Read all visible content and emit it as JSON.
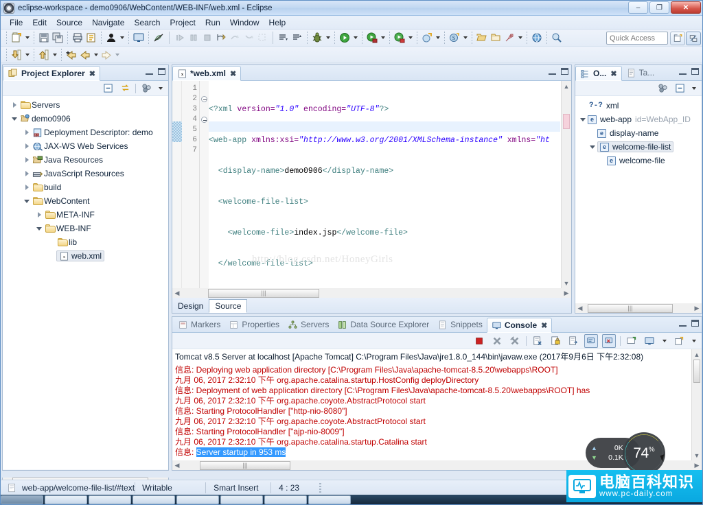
{
  "window": {
    "title": "eclipse-workspace - demo0906/WebContent/WEB-INF/web.xml - Eclipse",
    "minimize_label": "–",
    "restore_label": "❐",
    "close_label": "✕"
  },
  "menubar": {
    "items": [
      "File",
      "Edit",
      "Source",
      "Navigate",
      "Search",
      "Project",
      "Run",
      "Window",
      "Help"
    ]
  },
  "toolbar": {
    "quick_access_placeholder": "Quick Access",
    "row1_icons": [
      "new-wizard-icon",
      "new-wizard-dropdown",
      "save-icon",
      "save-all-icon",
      "print-icon",
      "link-icon",
      "person-icon",
      "person-dropdown",
      "open-console-icon",
      "toggle-mark-occurrences-icon",
      "resume-icon",
      "suspend-icon",
      "terminate-icon",
      "step-into-icon",
      "step-over-icon",
      "step-return-icon",
      "drop-to-frame-icon",
      "next-annotation-icon",
      "previous-annotation-icon",
      "debug-icon",
      "debug-dropdown",
      "run-icon",
      "run-dropdown",
      "run-server-icon",
      "run-server-dropdown",
      "stop-server-icon",
      "stop-server-dropdown",
      "new-java-project-icon",
      "new-java-project-dropdown",
      "new-servlet-icon",
      "new-servlet-dropdown",
      "open-type-icon",
      "open-task-icon",
      "rocket-icon",
      "rocket-dropdown",
      "web-browser-icon",
      "search-web-icon"
    ],
    "row2_icons": [
      "download-icon",
      "download-dropdown",
      "upload-icon",
      "upload-dropdown",
      "back-star-icon",
      "back-icon",
      "back-dropdown",
      "forward-icon",
      "forward-dropdown"
    ],
    "perspective_open_icon": "open-perspective-icon",
    "perspective_active_icon": "java-ee-perspective-icon"
  },
  "project_explorer": {
    "tab_label": "Project Explorer",
    "close_label": "✖",
    "view_icons": [
      "collapse-all-icon",
      "link-with-editor-icon",
      "view-menu-focus-icon",
      "view-menu-icon"
    ],
    "tree": [
      {
        "label": "Servers",
        "depth": 0,
        "arrow": "collapsed",
        "icon": "folder-icon",
        "selected": false
      },
      {
        "label": "demo0906",
        "depth": 0,
        "arrow": "expanded",
        "icon": "dynamic-web-project-icon",
        "selected": false
      },
      {
        "label": "Deployment Descriptor: demo",
        "depth": 1,
        "arrow": "collapsed",
        "icon": "deployment-descriptor-icon",
        "selected": false
      },
      {
        "label": "JAX-WS Web Services",
        "depth": 1,
        "arrow": "collapsed",
        "icon": "jaxws-icon",
        "selected": false
      },
      {
        "label": "Java Resources",
        "depth": 1,
        "arrow": "collapsed",
        "icon": "java-resources-icon",
        "selected": false
      },
      {
        "label": "JavaScript Resources",
        "depth": 1,
        "arrow": "collapsed",
        "icon": "javascript-resources-icon",
        "selected": false
      },
      {
        "label": "build",
        "depth": 1,
        "arrow": "collapsed",
        "icon": "folder-icon",
        "selected": false
      },
      {
        "label": "WebContent",
        "depth": 1,
        "arrow": "expanded",
        "icon": "folder-icon",
        "selected": false
      },
      {
        "label": "META-INF",
        "depth": 2,
        "arrow": "collapsed",
        "icon": "folder-icon",
        "selected": false
      },
      {
        "label": "WEB-INF",
        "depth": 2,
        "arrow": "expanded",
        "icon": "folder-icon",
        "selected": false
      },
      {
        "label": "lib",
        "depth": 3,
        "arrow": "none",
        "icon": "folder-icon",
        "selected": false
      },
      {
        "label": "web.xml",
        "depth": 3,
        "arrow": "none",
        "icon": "xml-file-icon",
        "selected": true
      }
    ]
  },
  "editor": {
    "tab_label": "*web.xml",
    "tab_icon": "xml-file-icon",
    "close_label": "✖",
    "footer_tabs": [
      {
        "label": "Design",
        "active": false
      },
      {
        "label": "Source",
        "active": true
      }
    ],
    "line_numbers": [
      "1",
      "2",
      "3",
      "4",
      "5",
      "6",
      "7"
    ],
    "lines": [
      {
        "n": 1,
        "fold": false,
        "segments": [
          {
            "t": "<?xml ",
            "c": "pi"
          },
          {
            "t": "version=",
            "c": "attr"
          },
          {
            "t": "\"1.0\"",
            "c": "str"
          },
          {
            "t": " encoding=",
            "c": "attr"
          },
          {
            "t": "\"UTF-8\"",
            "c": "str"
          },
          {
            "t": "?>",
            "c": "pi"
          }
        ]
      },
      {
        "n": 2,
        "fold": true,
        "segments": [
          {
            "t": "<web-app ",
            "c": "tag"
          },
          {
            "t": "xmlns:xsi=",
            "c": "attr"
          },
          {
            "t": "\"http://www.w3.org/2001/XMLSchema-instance\"",
            "c": "str"
          },
          {
            "t": " xmlns=",
            "c": "attr"
          },
          {
            "t": "\"ht",
            "c": "str"
          }
        ]
      },
      {
        "n": 3,
        "fold": false,
        "segments": [
          {
            "t": "  <display-name>",
            "c": "tag"
          },
          {
            "t": "demo0906",
            "c": "txt"
          },
          {
            "t": "</display-name>",
            "c": "tag"
          }
        ]
      },
      {
        "n": 4,
        "fold": true,
        "segments": [
          {
            "t": "  <welcome-file-list>",
            "c": "tag"
          }
        ]
      },
      {
        "n": 5,
        "fold": false,
        "segments": [
          {
            "t": "    <welcome-file>",
            "c": "tag"
          },
          {
            "t": "index.jsp",
            "c": "txt"
          },
          {
            "t": "</welcome-file>",
            "c": "tag"
          }
        ]
      },
      {
        "n": 6,
        "fold": false,
        "segments": [
          {
            "t": "  </welcome-file-list>",
            "c": "tag"
          }
        ]
      },
      {
        "n": 7,
        "fold": false,
        "segments": [
          {
            "t": "</web-app>",
            "c": "tag"
          }
        ]
      }
    ]
  },
  "outline": {
    "tabs": [
      {
        "label": "O...",
        "icon": "outline-icon",
        "active": true,
        "close_label": "✖"
      },
      {
        "label": "Ta...",
        "icon": "task-list-icon",
        "active": false
      }
    ],
    "view_icons": [
      "sort-icon",
      "collapse-all-icon",
      "view-menu-icon"
    ],
    "tree": [
      {
        "label": "xml",
        "depth": 1,
        "arrow": "none",
        "kind": "pi",
        "badge": "?-?",
        "suffix": "",
        "selected": false
      },
      {
        "label": "web-app",
        "depth": 0,
        "arrow": "expanded",
        "kind": "element",
        "badge": "e",
        "suffix": "id=WebApp_ID",
        "selected": false
      },
      {
        "label": "display-name",
        "depth": 1,
        "arrow": "none",
        "kind": "element",
        "badge": "e",
        "suffix": "",
        "selected": false
      },
      {
        "label": "welcome-file-list",
        "depth": 1,
        "arrow": "expanded",
        "kind": "element",
        "badge": "e",
        "suffix": "",
        "selected": true
      },
      {
        "label": "welcome-file",
        "depth": 2,
        "arrow": "none",
        "kind": "element",
        "badge": "e",
        "suffix": "",
        "selected": false
      }
    ]
  },
  "bottom_panel": {
    "tabs": [
      {
        "label": "Markers",
        "icon": "markers-icon",
        "active": false
      },
      {
        "label": "Properties",
        "icon": "properties-icon",
        "active": false
      },
      {
        "label": "Servers",
        "icon": "servers-icon",
        "active": false
      },
      {
        "label": "Data Source Explorer",
        "icon": "data-source-explorer-icon",
        "active": false
      },
      {
        "label": "Snippets",
        "icon": "snippets-icon",
        "active": false
      },
      {
        "label": "Console",
        "icon": "console-icon",
        "active": true,
        "close_label": "✖"
      }
    ],
    "toolbar_icons": [
      "terminate-icon",
      "remove-launch-icon",
      "remove-all-terminated-icon",
      "clear-console-icon",
      "scroll-lock-icon",
      "word-wrap-icon",
      "show-console-on-output-icon",
      "pin-console-icon",
      "display-selected-console-icon",
      "open-console-icon",
      "open-console-dropdown",
      "new-console-view-icon",
      "new-console-view-dropdown"
    ],
    "console_header": "Tomcat v8.5 Server at localhost [Apache Tomcat] C:\\Program Files\\Java\\jre1.8.0_144\\bin\\javaw.exe (2017年9月6日 下午2:32:08)",
    "console_lines": [
      {
        "text": "信息: Deploying web application directory [C:\\Program Files\\Java\\apache-tomcat-8.5.20\\webapps\\ROOT]",
        "highlight": ""
      },
      {
        "text": "九月 06, 2017 2:32:10 下午 org.apache.catalina.startup.HostConfig deployDirectory",
        "highlight": ""
      },
      {
        "text": "信息: Deployment of web application directory [C:\\Program Files\\Java\\apache-tomcat-8.5.20\\webapps\\ROOT] has",
        "highlight": ""
      },
      {
        "text": "九月 06, 2017 2:32:10 下午 org.apache.coyote.AbstractProtocol start",
        "highlight": ""
      },
      {
        "text": "信息: Starting ProtocolHandler [\"http-nio-8080\"]",
        "highlight": ""
      },
      {
        "text": "九月 06, 2017 2:32:10 下午 org.apache.coyote.AbstractProtocol start",
        "highlight": ""
      },
      {
        "text": "信息: Starting ProtocolHandler [\"ajp-nio-8009\"]",
        "highlight": ""
      },
      {
        "text": "九月 06, 2017 2:32:10 下午 org.apache.catalina.startup.Catalina start",
        "highlight": ""
      },
      {
        "text": "信息: ",
        "highlight": "Server startup in 953 ms"
      }
    ]
  },
  "statusbar": {
    "path_icon": "file-icon",
    "path": "web-app/welcome-file-list/#text",
    "writable": "Writable",
    "insert_mode": "Smart Insert",
    "cursor_position": "4 : 23"
  },
  "overlays": {
    "watermark": "http://blog.csdn.net/HoneyGirls",
    "net_up": "0K/s",
    "net_down": "0.1K/s",
    "net_up_icon": "arrow-up-icon",
    "net_down_icon": "arrow-down-icon",
    "cpu_value": "74",
    "cpu_unit": "%",
    "brand_cn": "电脑百科知识",
    "brand_url": "www.pc-daily.com",
    "brand_icon": "monitor-icon"
  },
  "colors": {
    "accent": "#3399ff",
    "tag": "#3f7f7f",
    "attr": "#7f007f",
    "string": "#2a00ff",
    "console_text": "#c00000",
    "brand": "#0aa8e0"
  }
}
